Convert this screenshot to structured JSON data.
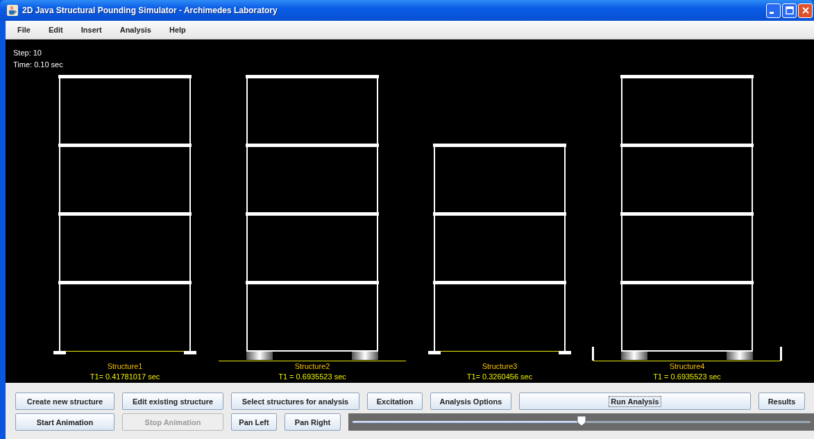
{
  "window": {
    "title": "2D Java Structural Pounding Simulator - Archimedes Laboratory"
  },
  "menu": [
    "File",
    "Edit",
    "Insert",
    "Analysis",
    "Help"
  ],
  "canvas": {
    "step": "Step:  10",
    "time": "Time:  0.10 sec",
    "structures": [
      {
        "name": "Structure1",
        "period": "T1=  0.41781017 sec",
        "short": false,
        "kind": "fixed"
      },
      {
        "name": "Structure2",
        "period": "T1 =  0.6935523 sec",
        "short": false,
        "kind": "isolated"
      },
      {
        "name": "Structure3",
        "period": "T1=  0.3260456 sec",
        "short": true,
        "kind": "fixed"
      },
      {
        "name": "Structure4",
        "period": "T1 =  0.6935523 sec",
        "short": false,
        "kind": "isolated_moat"
      }
    ]
  },
  "buttons_row1": [
    {
      "label": "Create new structure",
      "disabled": false,
      "focused": false
    },
    {
      "label": "Edit existing structure",
      "disabled": false,
      "focused": false
    },
    {
      "label": "Select structures for analysis",
      "disabled": false,
      "focused": false
    },
    {
      "label": "Excitation",
      "disabled": false,
      "focused": false
    },
    {
      "label": "Analysis Options",
      "disabled": false,
      "focused": false
    },
    {
      "label": "Run Analysis",
      "disabled": false,
      "focused": true
    },
    {
      "label": "Results",
      "disabled": false,
      "focused": false
    }
  ],
  "buttons_row2": [
    {
      "label": "Start Animation",
      "disabled": false,
      "focused": false
    },
    {
      "label": "Stop Animation",
      "disabled": true,
      "focused": false
    },
    {
      "label": "Pan Left",
      "disabled": false,
      "focused": false
    },
    {
      "label": "Pan Right",
      "disabled": false,
      "focused": false
    }
  ],
  "time_slider": {
    "level": 0.5
  }
}
